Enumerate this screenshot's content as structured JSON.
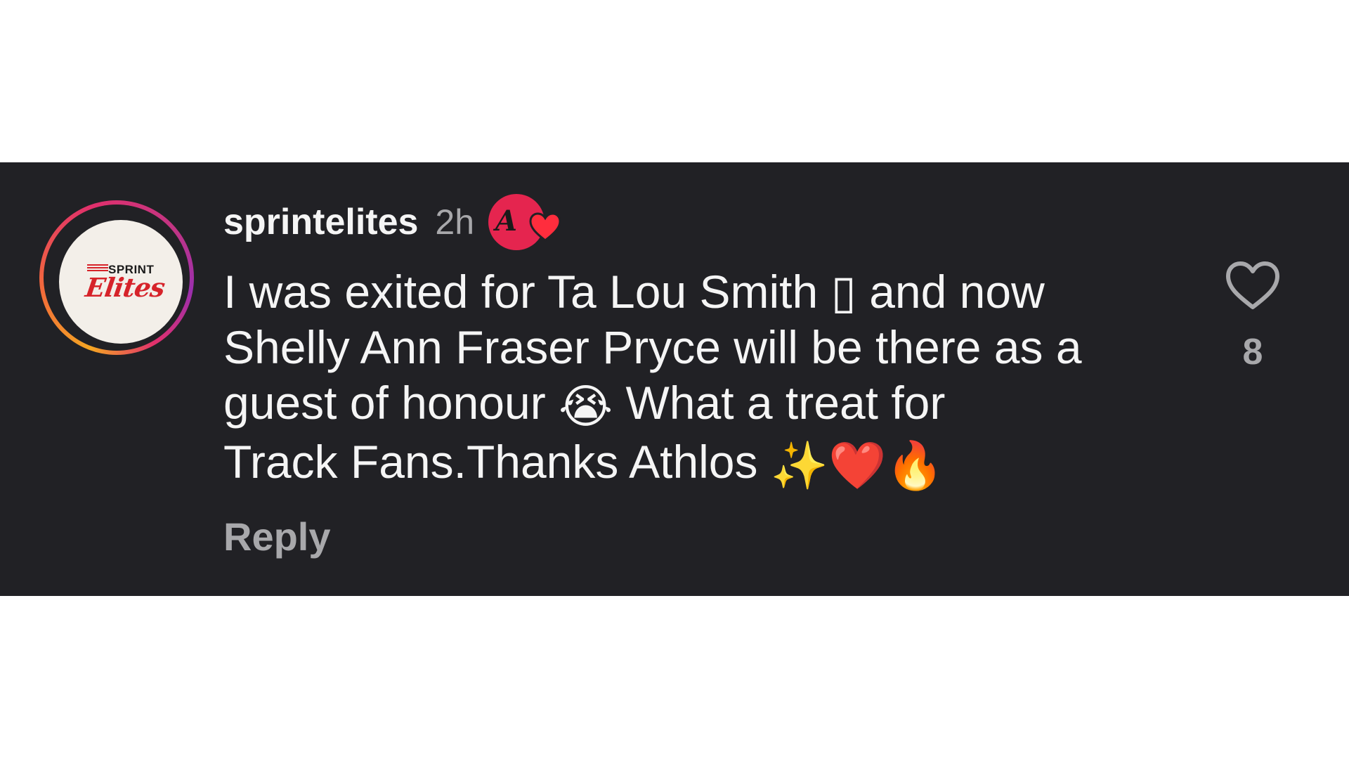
{
  "comment": {
    "username": "sprintelites",
    "time": "2h",
    "avatar": {
      "logo_top": "SPRINT",
      "logo_bottom": "Elites"
    },
    "author_badge": {
      "icon": "creator-liked-badge",
      "mark": "A",
      "accent": "#e5254f"
    },
    "text_lines": [
      "I was exited for Ta Lou Smith ▯ and now",
      "Shelly Ann Fraser Pryce will be there as a",
      "guest of honour",
      "What a treat for",
      "Track Fans.Thanks Athlos"
    ],
    "emojis": {
      "crying": "😭",
      "sparkles": "✨",
      "heart": "❤️",
      "fire": "🔥"
    },
    "reply_label": "Reply",
    "like_icon": "heart-outline-icon",
    "like_count": "8"
  },
  "colors": {
    "panel_bg": "#212125",
    "text": "#f5f5f5",
    "muted": "#a8a8ab",
    "brand_red": "#d6232a"
  }
}
